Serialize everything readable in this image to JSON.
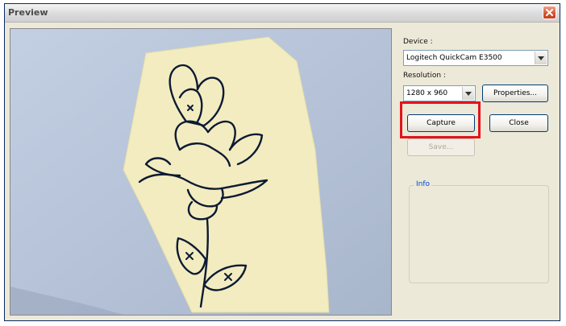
{
  "window": {
    "title": "Preview",
    "border_color": "#0a2a66"
  },
  "preview": {
    "background_color": "#b9c5d9",
    "paper_color": "#f2ecc0",
    "ink_color": "#0d1a33"
  },
  "device": {
    "label": "Device :",
    "selected": "Logitech QuickCam E3500"
  },
  "resolution": {
    "label": "Resolution :",
    "selected": "1280 x 960"
  },
  "buttons": {
    "properties": "Properties...",
    "capture": "Capture",
    "close": "Close",
    "save": "Save..."
  },
  "info": {
    "legend": "Info"
  },
  "annotation": {
    "highlight_color": "#e2141c",
    "highlight_target": "capture"
  }
}
